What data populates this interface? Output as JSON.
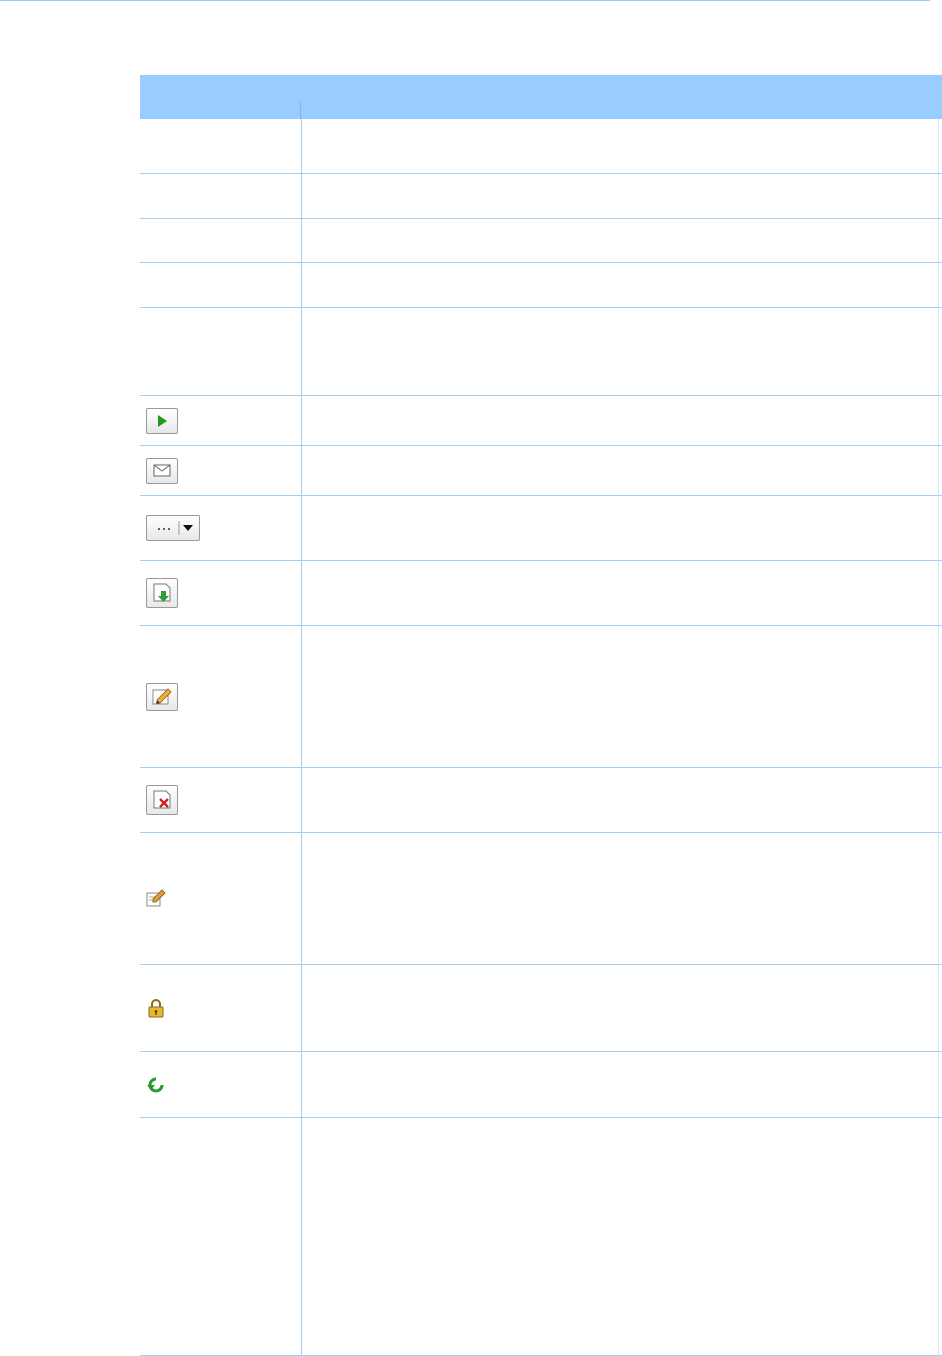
{
  "table": {
    "header": {
      "name": "",
      "description": ""
    },
    "rows": [
      {
        "icon": "none"
      },
      {
        "icon": "none"
      },
      {
        "icon": "none"
      },
      {
        "icon": "none"
      },
      {
        "icon": "none"
      },
      {
        "icon": "play-icon"
      },
      {
        "icon": "envelope-icon"
      },
      {
        "icon": "more-dropdown-icon"
      },
      {
        "icon": "download-icon"
      },
      {
        "icon": "pencil-icon"
      },
      {
        "icon": "delete-icon"
      },
      {
        "icon": "edit-note-icon"
      },
      {
        "icon": "lock-icon"
      },
      {
        "icon": "refresh-icon"
      },
      {
        "icon": "none"
      }
    ]
  },
  "colors": {
    "header_bg": "#99ccff",
    "rule": "#a9cdf0"
  }
}
